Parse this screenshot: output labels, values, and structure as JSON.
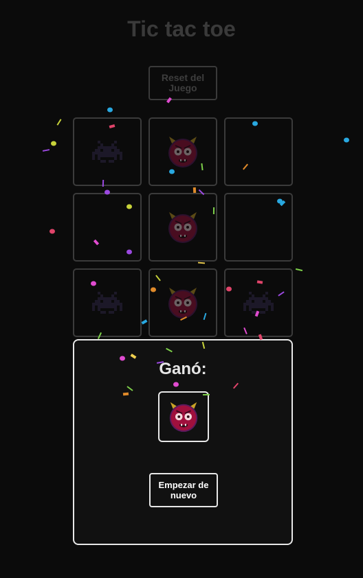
{
  "header": {
    "title": "Tic tac toe"
  },
  "controls": {
    "reset_label": "Reset del Juego"
  },
  "board": {
    "cells": [
      {
        "piece": "invader-icon"
      },
      {
        "piece": "devil-icon"
      },
      {
        "piece": ""
      },
      {
        "piece": ""
      },
      {
        "piece": "devil-icon"
      },
      {
        "piece": ""
      },
      {
        "piece": "invader-icon"
      },
      {
        "piece": "devil-icon"
      },
      {
        "piece": "invader-icon"
      }
    ]
  },
  "result": {
    "winner_text": "Ganó:",
    "winner_piece": "devil-icon",
    "restart_label": "Empezar de nuevo"
  },
  "colors": {
    "background": "#0b0b0b",
    "invader": "#2a2440",
    "devil_face": "#a0103d",
    "devil_horn": "#c9a227",
    "confetti": [
      "#29a8e0",
      "#c8d33a",
      "#e0446a",
      "#9b49e0",
      "#7ed04a",
      "#e08a2a",
      "#e04bd0",
      "#f0d050"
    ]
  }
}
